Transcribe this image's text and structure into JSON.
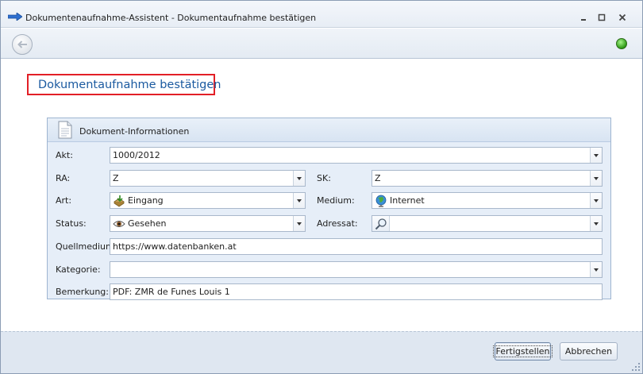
{
  "window": {
    "title": "Dokumentenaufnahme-Assistent - Dokumentaufnahme bestätigen",
    "controls": [
      "minimize",
      "maximize",
      "close"
    ]
  },
  "toolbar": {
    "back_icon": "back-arrow-icon",
    "status_color": "#3aa81e"
  },
  "page": {
    "title": "Dokumentaufnahme bestätigen",
    "highlight_color": "#e21f26"
  },
  "group": {
    "title": "Dokument-Informationen",
    "icon": "document-icon"
  },
  "fields": {
    "akt": {
      "label": "Akt:",
      "value": "1000/2012"
    },
    "ra": {
      "label": "RA:",
      "value": "Z"
    },
    "sk": {
      "label": "SK:",
      "value": "Z"
    },
    "art": {
      "label": "Art:",
      "value": "Eingang",
      "icon": "inbox-icon"
    },
    "medium": {
      "label": "Medium:",
      "value": "Internet",
      "icon": "globe-icon"
    },
    "status": {
      "label": "Status:",
      "value": "Gesehen",
      "icon": "eye-icon"
    },
    "adressat": {
      "label": "Adressat:",
      "value": "",
      "icon": "magnifier-icon"
    },
    "quellmedium": {
      "label": "Quellmedium:",
      "value": "https://www.datenbanken.at"
    },
    "kategorie": {
      "label": "Kategorie:",
      "value": ""
    },
    "bemerkung": {
      "label": "Bemerkung:",
      "value": "PDF: ZMR de Funes Louis 1"
    }
  },
  "footer": {
    "finish_label": "Fertigstellen",
    "cancel_label": "Abbrechen"
  }
}
